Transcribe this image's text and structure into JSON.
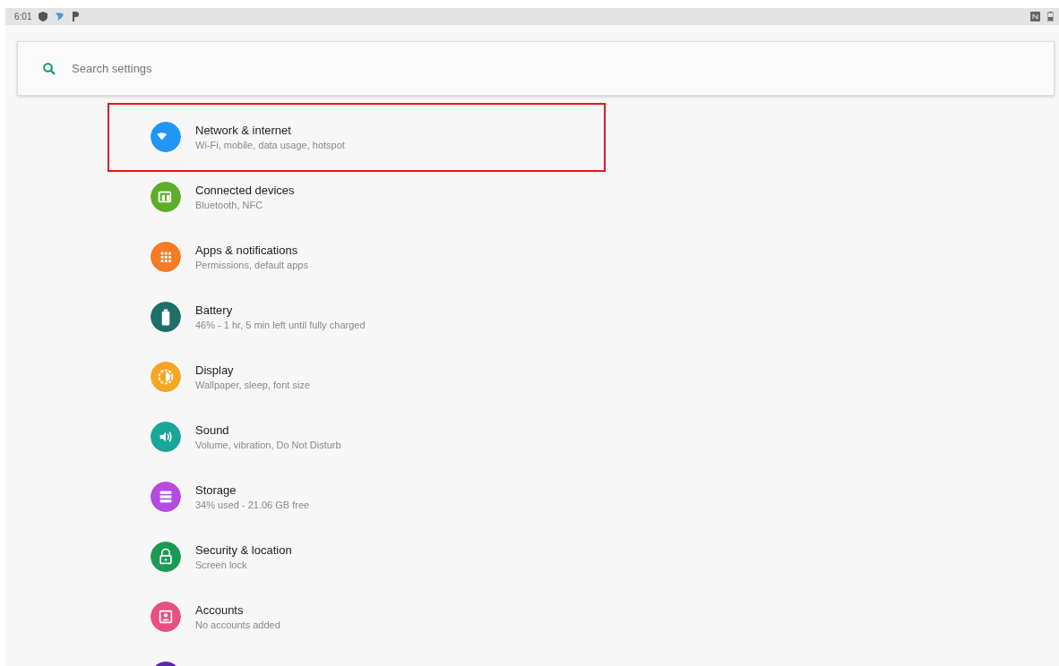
{
  "status_bar": {
    "time": "6:01"
  },
  "search": {
    "placeholder": "Search settings"
  },
  "items": [
    {
      "kind": "wifi",
      "title": "Network & internet",
      "summary": "Wi-Fi, mobile, data usage, hotspot",
      "color": "#2196f3",
      "highlighted": true
    },
    {
      "kind": "devices",
      "title": "Connected devices",
      "summary": "Bluetooth, NFC",
      "color": "#5fae2a",
      "highlighted": false
    },
    {
      "kind": "apps",
      "title": "Apps & notifications",
      "summary": "Permissions, default apps",
      "color": "#f57c22",
      "highlighted": false
    },
    {
      "kind": "battery",
      "title": "Battery",
      "summary": "46% - 1 hr, 5 min left until fully charged",
      "color": "#1e6f67",
      "highlighted": false
    },
    {
      "kind": "display",
      "title": "Display",
      "summary": "Wallpaper, sleep, font size",
      "color": "#f5a623",
      "highlighted": false
    },
    {
      "kind": "sound",
      "title": "Sound",
      "summary": "Volume, vibration, Do Not Disturb",
      "color": "#1aa79a",
      "highlighted": false
    },
    {
      "kind": "storage",
      "title": "Storage",
      "summary": "34% used - 21.06 GB free",
      "color": "#b44ae0",
      "highlighted": false
    },
    {
      "kind": "security",
      "title": "Security & location",
      "summary": "Screen lock",
      "color": "#1b9a55",
      "highlighted": false
    },
    {
      "kind": "accounts",
      "title": "Accounts",
      "summary": "No accounts added",
      "color": "#e84f84",
      "highlighted": false
    },
    {
      "kind": "accessibility",
      "color": "#5b25b4",
      "highlighted": false
    }
  ]
}
